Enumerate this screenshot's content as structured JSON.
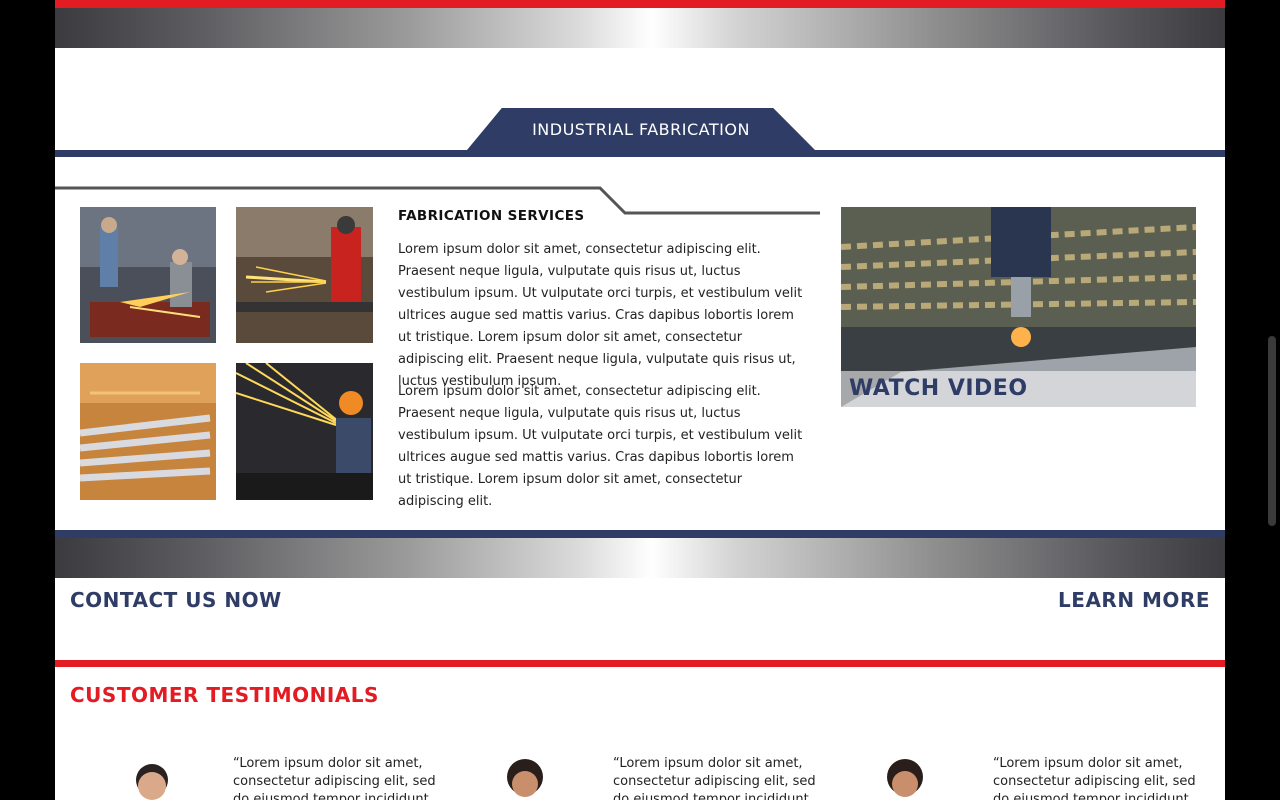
{
  "section": {
    "title": "INDUSTRIAL FABRICATION"
  },
  "services": {
    "title": "FABRICATION SERVICES",
    "paragraphs": [
      "Lorem ipsum dolor sit amet, consectetur adipiscing elit. Praesent neque ligula, vulputate quis risus ut, luctus vestibulum ipsum. Ut vulputate orci turpis, et vestibulum velit ultrices augue sed mattis varius. Cras dapibus lobortis lorem ut tristique. Lorem ipsum dolor sit amet, consectetur adipiscing elit. Praesent neque ligula, vulputate quis risus ut, luctus vestibulum ipsum.",
      "Lorem ipsum dolor sit amet, consectetur adipiscing elit. Praesent neque ligula, vulputate quis risus ut, luctus vestibulum ipsum. Ut vulputate orci turpis, et vestibulum velit ultrices augue sed mattis varius. Cras dapibus lobortis lorem ut tristique. Lorem ipsum dolor sit amet, consectetur adipiscing elit."
    ]
  },
  "video": {
    "label": "WATCH VIDEO"
  },
  "cta": {
    "contact": "CONTACT US NOW",
    "learn": "LEARN MORE"
  },
  "testimonials": {
    "title": "CUSTOMER TESTIMONIALS",
    "items": [
      {
        "quote": "“Lorem ipsum dolor sit amet, consectetur adipiscing elit, sed do eiusmod tempor incididunt ut"
      },
      {
        "quote": "“Lorem ipsum dolor sit amet, consectetur adipiscing elit, sed do eiusmod tempor incididunt ut"
      },
      {
        "quote": "“Lorem ipsum dolor sit amet, consectetur adipiscing elit, sed do eiusmod tempor incididunt ut"
      }
    ]
  },
  "colors": {
    "navy": "#2f3d66",
    "red": "#e31b23"
  }
}
